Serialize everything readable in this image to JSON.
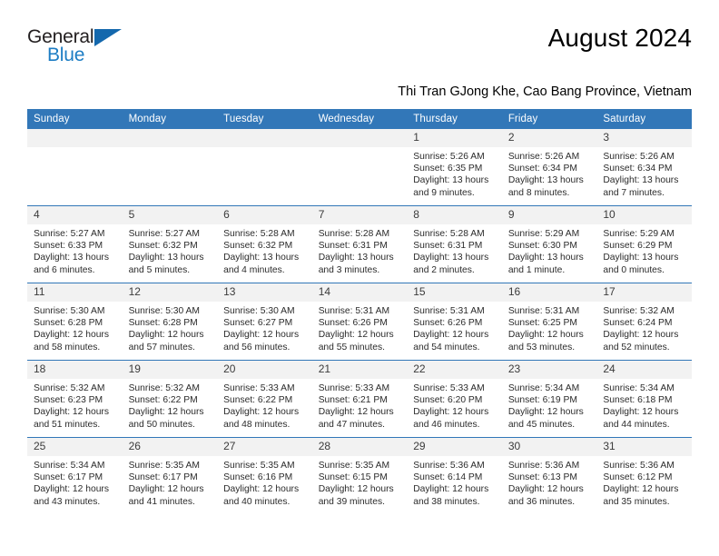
{
  "brand": {
    "name_part1": "General",
    "name_part2": "Blue"
  },
  "header": {
    "month_title": "August 2024",
    "location": "Thi Tran GJong Khe, Cao Bang Province, Vietnam"
  },
  "colors": {
    "header_bar": "#3277b8",
    "brand_blue": "#1d7dc4",
    "daynum_band": "#f2f2f2"
  },
  "weekdays": [
    "Sunday",
    "Monday",
    "Tuesday",
    "Wednesday",
    "Thursday",
    "Friday",
    "Saturday"
  ],
  "labels": {
    "sunrise_prefix": "Sunrise:",
    "sunset_prefix": "Sunset:",
    "daylight_prefix": "Daylight:"
  },
  "weeks": [
    [
      {
        "day": "",
        "empty": true,
        "sunrise": "",
        "sunset": "",
        "daylight_line1": "",
        "daylight_line2": ""
      },
      {
        "day": "",
        "empty": true,
        "sunrise": "",
        "sunset": "",
        "daylight_line1": "",
        "daylight_line2": ""
      },
      {
        "day": "",
        "empty": true,
        "sunrise": "",
        "sunset": "",
        "daylight_line1": "",
        "daylight_line2": ""
      },
      {
        "day": "",
        "empty": true,
        "sunrise": "",
        "sunset": "",
        "daylight_line1": "",
        "daylight_line2": ""
      },
      {
        "day": "1",
        "sunrise": "Sunrise: 5:26 AM",
        "sunset": "Sunset: 6:35 PM",
        "daylight_line1": "Daylight: 13 hours",
        "daylight_line2": "and 9 minutes."
      },
      {
        "day": "2",
        "sunrise": "Sunrise: 5:26 AM",
        "sunset": "Sunset: 6:34 PM",
        "daylight_line1": "Daylight: 13 hours",
        "daylight_line2": "and 8 minutes."
      },
      {
        "day": "3",
        "sunrise": "Sunrise: 5:26 AM",
        "sunset": "Sunset: 6:34 PM",
        "daylight_line1": "Daylight: 13 hours",
        "daylight_line2": "and 7 minutes."
      }
    ],
    [
      {
        "day": "4",
        "sunrise": "Sunrise: 5:27 AM",
        "sunset": "Sunset: 6:33 PM",
        "daylight_line1": "Daylight: 13 hours",
        "daylight_line2": "and 6 minutes."
      },
      {
        "day": "5",
        "sunrise": "Sunrise: 5:27 AM",
        "sunset": "Sunset: 6:32 PM",
        "daylight_line1": "Daylight: 13 hours",
        "daylight_line2": "and 5 minutes."
      },
      {
        "day": "6",
        "sunrise": "Sunrise: 5:28 AM",
        "sunset": "Sunset: 6:32 PM",
        "daylight_line1": "Daylight: 13 hours",
        "daylight_line2": "and 4 minutes."
      },
      {
        "day": "7",
        "sunrise": "Sunrise: 5:28 AM",
        "sunset": "Sunset: 6:31 PM",
        "daylight_line1": "Daylight: 13 hours",
        "daylight_line2": "and 3 minutes."
      },
      {
        "day": "8",
        "sunrise": "Sunrise: 5:28 AM",
        "sunset": "Sunset: 6:31 PM",
        "daylight_line1": "Daylight: 13 hours",
        "daylight_line2": "and 2 minutes."
      },
      {
        "day": "9",
        "sunrise": "Sunrise: 5:29 AM",
        "sunset": "Sunset: 6:30 PM",
        "daylight_line1": "Daylight: 13 hours",
        "daylight_line2": "and 1 minute."
      },
      {
        "day": "10",
        "sunrise": "Sunrise: 5:29 AM",
        "sunset": "Sunset: 6:29 PM",
        "daylight_line1": "Daylight: 13 hours",
        "daylight_line2": "and 0 minutes."
      }
    ],
    [
      {
        "day": "11",
        "sunrise": "Sunrise: 5:30 AM",
        "sunset": "Sunset: 6:28 PM",
        "daylight_line1": "Daylight: 12 hours",
        "daylight_line2": "and 58 minutes."
      },
      {
        "day": "12",
        "sunrise": "Sunrise: 5:30 AM",
        "sunset": "Sunset: 6:28 PM",
        "daylight_line1": "Daylight: 12 hours",
        "daylight_line2": "and 57 minutes."
      },
      {
        "day": "13",
        "sunrise": "Sunrise: 5:30 AM",
        "sunset": "Sunset: 6:27 PM",
        "daylight_line1": "Daylight: 12 hours",
        "daylight_line2": "and 56 minutes."
      },
      {
        "day": "14",
        "sunrise": "Sunrise: 5:31 AM",
        "sunset": "Sunset: 6:26 PM",
        "daylight_line1": "Daylight: 12 hours",
        "daylight_line2": "and 55 minutes."
      },
      {
        "day": "15",
        "sunrise": "Sunrise: 5:31 AM",
        "sunset": "Sunset: 6:26 PM",
        "daylight_line1": "Daylight: 12 hours",
        "daylight_line2": "and 54 minutes."
      },
      {
        "day": "16",
        "sunrise": "Sunrise: 5:31 AM",
        "sunset": "Sunset: 6:25 PM",
        "daylight_line1": "Daylight: 12 hours",
        "daylight_line2": "and 53 minutes."
      },
      {
        "day": "17",
        "sunrise": "Sunrise: 5:32 AM",
        "sunset": "Sunset: 6:24 PM",
        "daylight_line1": "Daylight: 12 hours",
        "daylight_line2": "and 52 minutes."
      }
    ],
    [
      {
        "day": "18",
        "sunrise": "Sunrise: 5:32 AM",
        "sunset": "Sunset: 6:23 PM",
        "daylight_line1": "Daylight: 12 hours",
        "daylight_line2": "and 51 minutes."
      },
      {
        "day": "19",
        "sunrise": "Sunrise: 5:32 AM",
        "sunset": "Sunset: 6:22 PM",
        "daylight_line1": "Daylight: 12 hours",
        "daylight_line2": "and 50 minutes."
      },
      {
        "day": "20",
        "sunrise": "Sunrise: 5:33 AM",
        "sunset": "Sunset: 6:22 PM",
        "daylight_line1": "Daylight: 12 hours",
        "daylight_line2": "and 48 minutes."
      },
      {
        "day": "21",
        "sunrise": "Sunrise: 5:33 AM",
        "sunset": "Sunset: 6:21 PM",
        "daylight_line1": "Daylight: 12 hours",
        "daylight_line2": "and 47 minutes."
      },
      {
        "day": "22",
        "sunrise": "Sunrise: 5:33 AM",
        "sunset": "Sunset: 6:20 PM",
        "daylight_line1": "Daylight: 12 hours",
        "daylight_line2": "and 46 minutes."
      },
      {
        "day": "23",
        "sunrise": "Sunrise: 5:34 AM",
        "sunset": "Sunset: 6:19 PM",
        "daylight_line1": "Daylight: 12 hours",
        "daylight_line2": "and 45 minutes."
      },
      {
        "day": "24",
        "sunrise": "Sunrise: 5:34 AM",
        "sunset": "Sunset: 6:18 PM",
        "daylight_line1": "Daylight: 12 hours",
        "daylight_line2": "and 44 minutes."
      }
    ],
    [
      {
        "day": "25",
        "sunrise": "Sunrise: 5:34 AM",
        "sunset": "Sunset: 6:17 PM",
        "daylight_line1": "Daylight: 12 hours",
        "daylight_line2": "and 43 minutes."
      },
      {
        "day": "26",
        "sunrise": "Sunrise: 5:35 AM",
        "sunset": "Sunset: 6:17 PM",
        "daylight_line1": "Daylight: 12 hours",
        "daylight_line2": "and 41 minutes."
      },
      {
        "day": "27",
        "sunrise": "Sunrise: 5:35 AM",
        "sunset": "Sunset: 6:16 PM",
        "daylight_line1": "Daylight: 12 hours",
        "daylight_line2": "and 40 minutes."
      },
      {
        "day": "28",
        "sunrise": "Sunrise: 5:35 AM",
        "sunset": "Sunset: 6:15 PM",
        "daylight_line1": "Daylight: 12 hours",
        "daylight_line2": "and 39 minutes."
      },
      {
        "day": "29",
        "sunrise": "Sunrise: 5:36 AM",
        "sunset": "Sunset: 6:14 PM",
        "daylight_line1": "Daylight: 12 hours",
        "daylight_line2": "and 38 minutes."
      },
      {
        "day": "30",
        "sunrise": "Sunrise: 5:36 AM",
        "sunset": "Sunset: 6:13 PM",
        "daylight_line1": "Daylight: 12 hours",
        "daylight_line2": "and 36 minutes."
      },
      {
        "day": "31",
        "sunrise": "Sunrise: 5:36 AM",
        "sunset": "Sunset: 6:12 PM",
        "daylight_line1": "Daylight: 12 hours",
        "daylight_line2": "and 35 minutes."
      }
    ]
  ]
}
